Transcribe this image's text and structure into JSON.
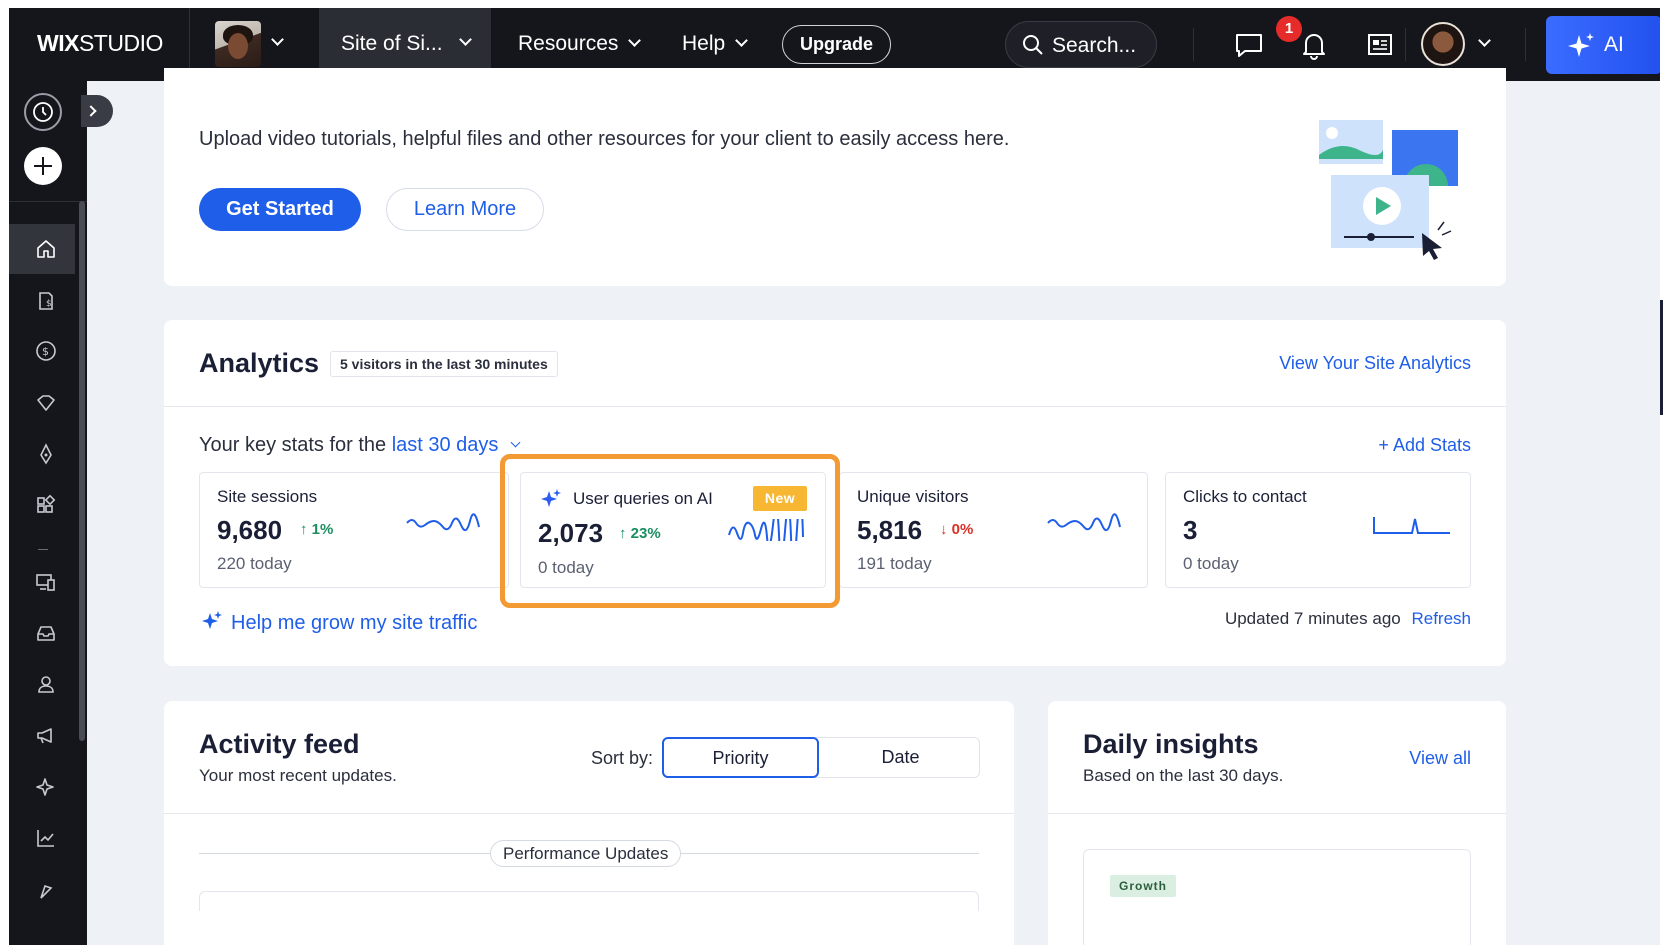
{
  "topbar": {
    "logo_bold": "WIX",
    "logo_light": "STUDIO",
    "site_name": "Site of Si...",
    "menus": [
      "Resources",
      "Help"
    ],
    "upgrade_label": "Upgrade",
    "search_placeholder": "Search...",
    "notification_count": "1",
    "ai_label": "AI"
  },
  "intro_card": {
    "description": "Upload video tutorials, helpful files and other resources for your client to easily access here.",
    "primary_button": "Get Started",
    "secondary_button": "Learn More"
  },
  "analytics": {
    "title": "Analytics",
    "visitors_pill": "5 visitors in the last 30 minutes",
    "view_link": "View Your Site Analytics",
    "key_stats_prefix": "Your key stats for the",
    "key_stats_period": "last 30 days",
    "add_stats": "+ Add Stats",
    "stats": [
      {
        "label": "Site sessions",
        "value": "9,680",
        "change": "↑ 1%",
        "direction": "up",
        "today": "220 today"
      },
      {
        "label": "User queries on AI",
        "value": "2,073",
        "change": "↑ 23%",
        "direction": "up",
        "today": "0 today",
        "badge": "New"
      },
      {
        "label": "Unique visitors",
        "value": "5,816",
        "change": "↓ 0%",
        "direction": "down",
        "today": "191 today"
      },
      {
        "label": "Clicks to contact",
        "value": "3",
        "change": "",
        "direction": "",
        "today": "0 today"
      }
    ],
    "grow_link": "Help me grow my site traffic",
    "updated_text": "Updated 7 minutes ago",
    "refresh_link": "Refresh"
  },
  "activity": {
    "title": "Activity feed",
    "subtitle": "Your most recent updates.",
    "sort_label": "Sort by:",
    "sort_options": [
      "Priority",
      "Date"
    ],
    "section_label": "Performance Updates"
  },
  "insights": {
    "title": "Daily insights",
    "subtitle": "Based on the last 30 days.",
    "view_all": "View all",
    "tag": "Growth"
  },
  "colors": {
    "accent": "#1f5ee8",
    "highlight": "#f39a35",
    "new_badge": "#f7b733",
    "topbar": "#15161b"
  }
}
